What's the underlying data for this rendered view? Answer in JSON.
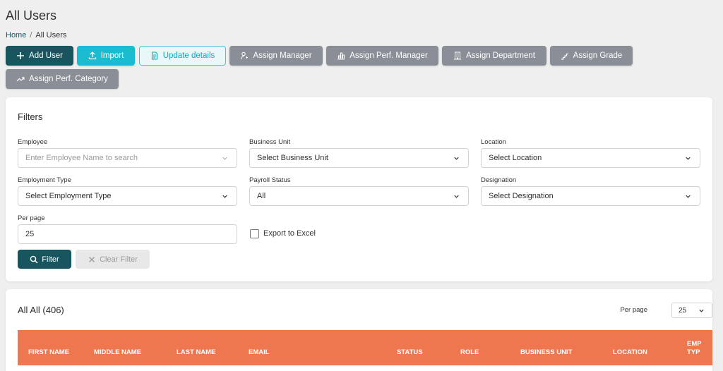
{
  "page": {
    "title": "All Users"
  },
  "breadcrumb": {
    "home": "Home",
    "separator": "/",
    "current": "All Users"
  },
  "toolbar": {
    "add_user": "Add User",
    "import": "Import",
    "update_details": "Update details",
    "assign_manager": "Assign Manager",
    "assign_perf_manager": "Assign Perf. Manager",
    "assign_department": "Assign Department",
    "assign_grade": "Assign Grade",
    "assign_perf_category": "Assign Perf. Category"
  },
  "filters": {
    "title": "Filters",
    "employee": {
      "label": "Employee",
      "placeholder": "Enter Employee Name to search"
    },
    "business_unit": {
      "label": "Business Unit",
      "value": "Select Business Unit"
    },
    "location": {
      "label": "Location",
      "value": "Select Location"
    },
    "employment_type": {
      "label": "Employment Type",
      "value": "Select Employment Type"
    },
    "payroll_status": {
      "label": "Payroll Status",
      "value": "All"
    },
    "designation": {
      "label": "Designation",
      "value": "Select Designation"
    },
    "per_page": {
      "label": "Per page",
      "value": "25"
    },
    "export_excel": {
      "label": "Export to Excel",
      "checked": false
    },
    "filter_button": "Filter",
    "clear_button": "Clear Filter"
  },
  "list": {
    "title": "All All (406)",
    "per_page_label": "Per page",
    "per_page_value": "25",
    "columns": [
      "FIRST NAME",
      "MIDDLE NAME",
      "LAST NAME",
      "EMAIL",
      "STATUS",
      "ROLE",
      "BUSINESS UNIT",
      "LOCATION",
      "EMP TYP"
    ]
  },
  "colors": {
    "primary_dark": "#17565f",
    "cyan": "#1bbcd0",
    "gray_button": "#8a8e96",
    "table_header": "#ee7750"
  },
  "icons": {
    "add": "plus-icon",
    "import": "upload-icon",
    "update": "document-icon",
    "manager": "user-key-icon",
    "perf_manager": "chart-bar-icon",
    "department": "building-icon",
    "grade": "steps-icon",
    "perf_category": "trend-up-icon",
    "filter": "search-icon",
    "clear": "close-icon",
    "dropdown": "chevron-down-icon"
  }
}
